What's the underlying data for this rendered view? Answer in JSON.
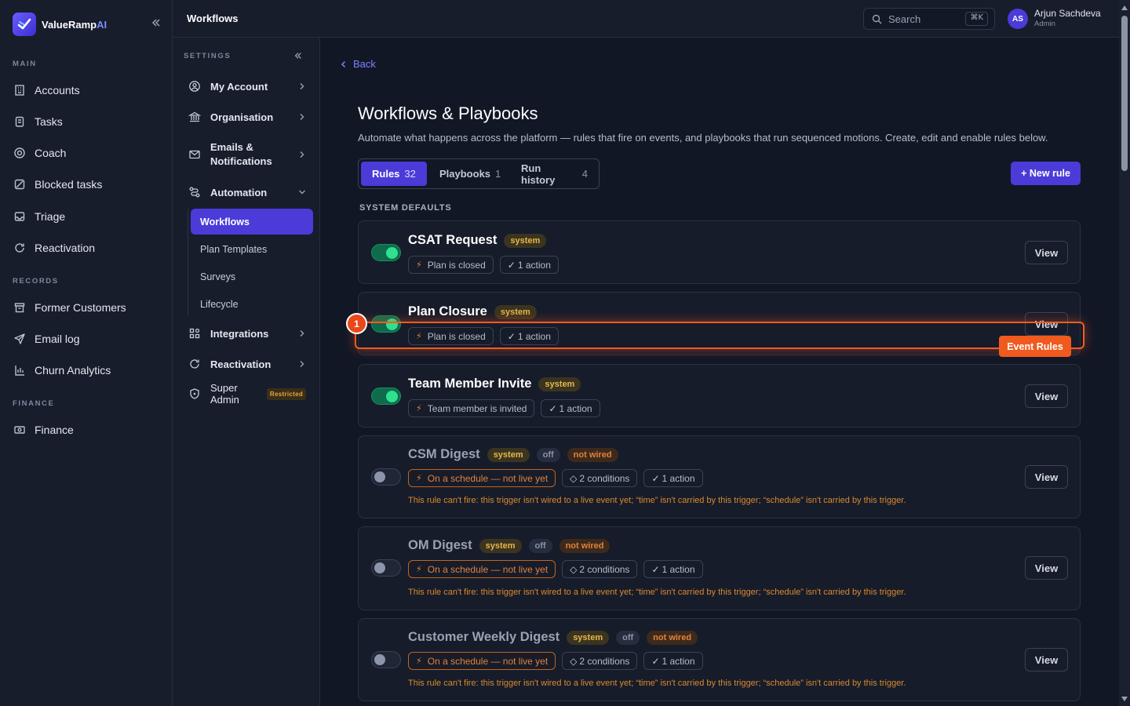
{
  "brand": {
    "name": "ValueRamp",
    "suffix": "AI"
  },
  "sidebar": {
    "sections": [
      {
        "label": "MAIN"
      },
      {
        "label": "RECORDS"
      },
      {
        "label": "FINANCE"
      }
    ],
    "items": [
      {
        "label": "Accounts",
        "icon": "building-icon"
      },
      {
        "label": "Tasks",
        "icon": "clipboard-icon"
      },
      {
        "label": "Coach",
        "icon": "target-icon"
      },
      {
        "label": "Blocked tasks",
        "icon": "blocked-icon"
      },
      {
        "label": "Triage",
        "icon": "inbox-icon"
      },
      {
        "label": "Reactivation",
        "icon": "refresh-icon"
      },
      {
        "label": "Former Customers",
        "icon": "archive-icon"
      },
      {
        "label": "Email log",
        "icon": "send-icon"
      },
      {
        "label": "Churn Analytics",
        "icon": "chart-icon"
      },
      {
        "label": "Finance",
        "icon": "cash-icon"
      }
    ]
  },
  "settings": {
    "header": "SETTINGS",
    "items": [
      {
        "label": "My Account",
        "icon": "user-circle-icon"
      },
      {
        "label": "Organisation",
        "icon": "bank-icon"
      },
      {
        "label": "Emails &",
        "label2": "Notifications",
        "icon": "mail-icon"
      },
      {
        "label": "Automation",
        "icon": "workflow-icon"
      },
      {
        "label": "Integrations",
        "icon": "grid-icon"
      },
      {
        "label": "Reactivation",
        "icon": "refresh-icon"
      },
      {
        "label": "Super Admin",
        "icon": "shield-icon",
        "badge": "Restricted"
      }
    ],
    "sub_items": [
      "Workflows",
      "Plan Templates",
      "Surveys",
      "Lifecycle"
    ]
  },
  "topbar": {
    "title": "Workflows",
    "search_placeholder": "Search",
    "shortcut": "⌘K",
    "user": {
      "initials": "AS",
      "name": "Arjun Sachdeva",
      "role": "Admin"
    }
  },
  "page": {
    "back": "Back",
    "title": "Workflows & Playbooks",
    "description": "Automate what happens across the platform — rules that fire on events, and playbooks that run sequenced motions. Create, edit and enable rules below.",
    "tabs": [
      {
        "label": "Rules",
        "count": "32"
      },
      {
        "label": "Playbooks",
        "count": "1"
      },
      {
        "label": "Run history",
        "count": "4"
      }
    ],
    "new_rule": "+ New rule",
    "section": "SYSTEM DEFAULTS",
    "view_label": "View"
  },
  "rules": [
    {
      "name": "CSAT Request",
      "badges": [
        "system"
      ],
      "trigger": "Plan is closed",
      "conditions": "",
      "actions": "1 action",
      "enabled": true,
      "warning": ""
    },
    {
      "name": "Plan Closure",
      "badges": [
        "system"
      ],
      "trigger": "Plan is closed",
      "conditions": "",
      "actions": "1 action",
      "enabled": true,
      "warning": ""
    },
    {
      "name": "Team Member Invite",
      "badges": [
        "system"
      ],
      "trigger": "Team member is invited",
      "conditions": "",
      "actions": "1 action",
      "enabled": true,
      "warning": ""
    },
    {
      "name": "CSM Digest",
      "badges": [
        "system",
        "off",
        "not wired"
      ],
      "trigger": "On a schedule — not live yet",
      "conditions": "2 conditions",
      "actions": "1 action",
      "enabled": false,
      "warning": "This rule can't fire: this trigger isn't wired to a live event yet; “time” isn't carried by this trigger; “schedule” isn't carried by this trigger."
    },
    {
      "name": "OM Digest",
      "badges": [
        "system",
        "off",
        "not wired"
      ],
      "trigger": "On a schedule — not live yet",
      "conditions": "2 conditions",
      "actions": "1 action",
      "enabled": false,
      "warning": "This rule can't fire: this trigger isn't wired to a live event yet; “time” isn't carried by this trigger; “schedule” isn't carried by this trigger."
    },
    {
      "name": "Customer Weekly Digest",
      "badges": [
        "system",
        "off",
        "not wired"
      ],
      "trigger": "On a schedule — not live yet",
      "conditions": "2 conditions",
      "actions": "1 action",
      "enabled": false,
      "warning": "This rule can't fire: this trigger isn't wired to a live event yet; “time” isn't carried by this trigger; “schedule” isn't carried by this trigger."
    }
  ],
  "highlight": {
    "number": "1",
    "label": "Event Rules"
  },
  "colors": {
    "accent": "#4b3bd8",
    "success": "#2fe08f",
    "warning": "#e0823c",
    "highlight": "#ff5a1f"
  }
}
